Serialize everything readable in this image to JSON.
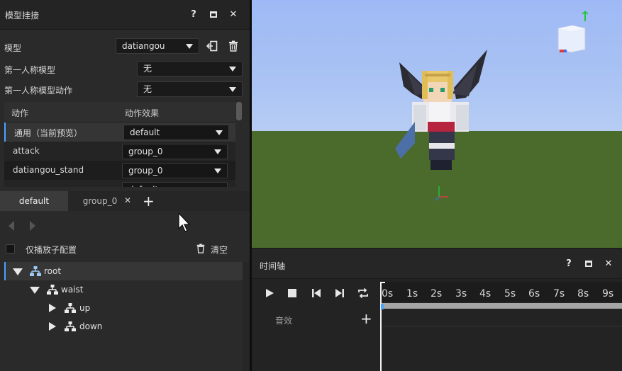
{
  "left_panel": {
    "title": "模型挂接",
    "title_buttons": {
      "help": "?",
      "max": "□",
      "close": "✕"
    },
    "model_label": "模型",
    "model_value": "datiangou",
    "first_person_model_label": "第一人称模型",
    "first_person_model_value": "无",
    "first_person_anim_label": "第一人称模型动作",
    "first_person_anim_value": "无",
    "table": {
      "headers": [
        "动作",
        "动作效果"
      ],
      "rows": [
        {
          "action": "通用（当前预览）",
          "effect": "default"
        },
        {
          "action": "attack",
          "effect": "group_0"
        },
        {
          "action": "datiangou_stand",
          "effect": "group_0"
        },
        {
          "action": "",
          "effect": "default"
        }
      ]
    },
    "tabs": [
      "default",
      "group_0"
    ],
    "tab_close": "✕",
    "tab_add": "+",
    "only_particle_label": "仅播放子配置",
    "clear_label": "清空",
    "tree": [
      {
        "label": "root",
        "level": 0
      },
      {
        "label": "waist",
        "level": 1
      },
      {
        "label": "up",
        "level": 2
      },
      {
        "label": "down",
        "level": 2
      }
    ]
  },
  "timeline": {
    "title": "时间轴",
    "title_buttons": {
      "help": "?",
      "max": "□",
      "close": "✕"
    },
    "ticks": [
      "0s",
      "1s",
      "2s",
      "3s",
      "4s",
      "5s",
      "6s",
      "7s",
      "8s",
      "9s"
    ],
    "track_label": "音效",
    "track_add": "+"
  },
  "colors": {
    "accent": "#4aa3ff",
    "panel": "#2a2a2a",
    "sky": "#a9c2f4",
    "grass": "#4b6b2c"
  }
}
